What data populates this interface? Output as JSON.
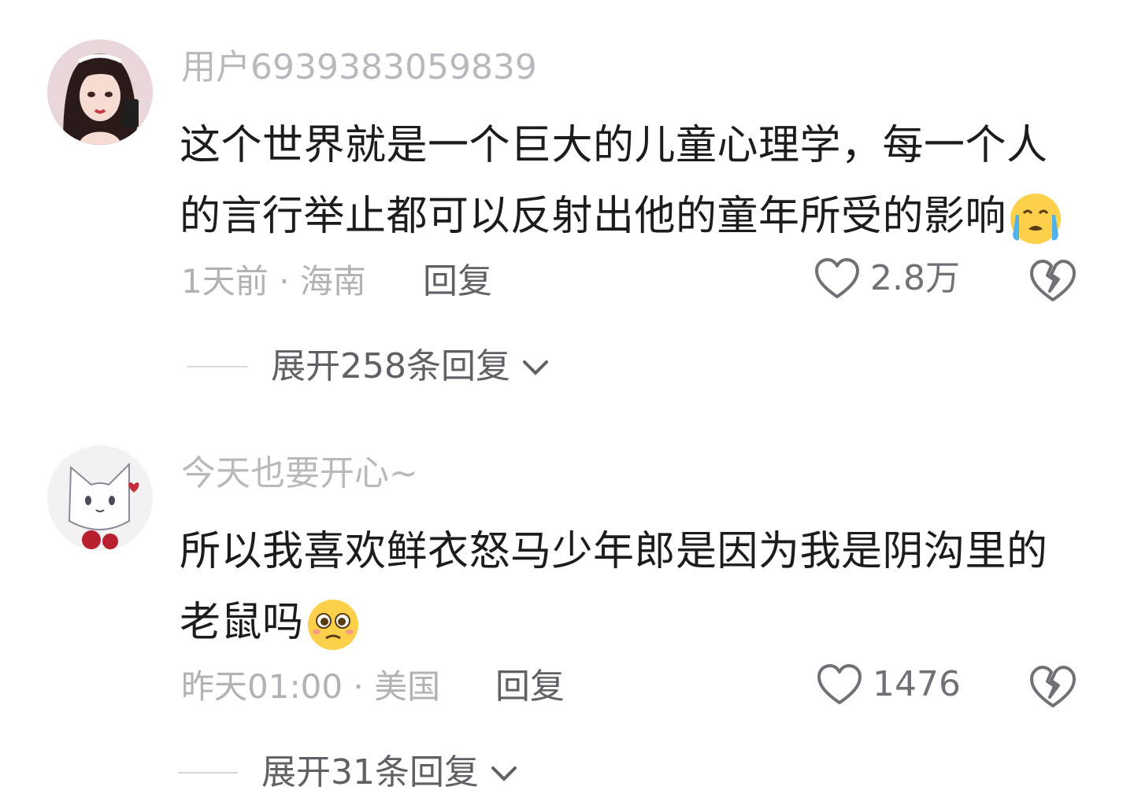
{
  "comments": [
    {
      "username": "用户6939383059839",
      "avatar_icon": "girl-avatar-icon",
      "text": "这个世界就是一个巨大的儿童心理学，每一个人的言行举止都可以反射出他的童年所受的影响",
      "emoji": "loudly-crying-emoji",
      "time_location": "1天前 · 海南",
      "reply_label": "回复",
      "like_count": "2.8万",
      "expand_label": "展开258条回复"
    },
    {
      "username": "今天也要开心~",
      "avatar_icon": "cat-avatar-icon",
      "text": "所以我喜欢鲜衣怒马少年郎是因为我是阴沟里的老鼠吗",
      "emoji": "pleading-face-emoji",
      "time_location": "昨天01:00 · 美国",
      "reply_label": "回复",
      "like_count": "1476",
      "expand_label": "展开31条回复"
    }
  ],
  "colors": {
    "username": "#b9b9bd",
    "text": "#1c1c1c",
    "meta": "#b1b1b6",
    "action": "#606066"
  }
}
